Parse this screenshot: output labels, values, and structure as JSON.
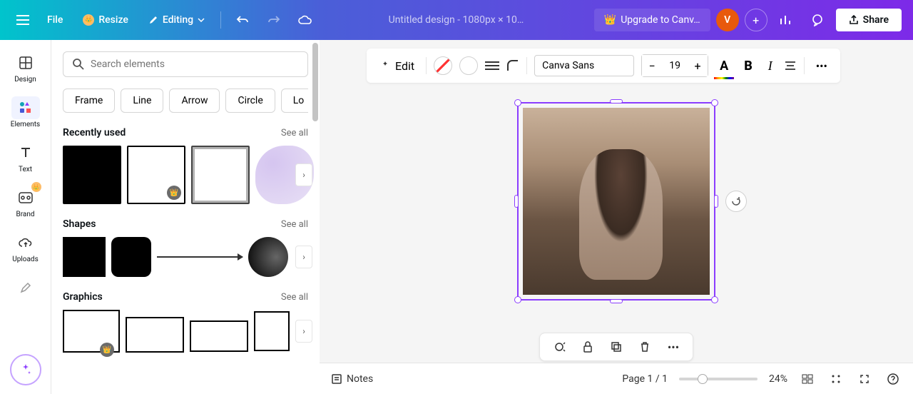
{
  "topbar": {
    "file": "File",
    "resize": "Resize",
    "editing": "Editing",
    "doc_title": "Untitled design - 1080px × 10…",
    "upgrade": "Upgrade to Canv…",
    "avatar_initial": "V",
    "share": "Share"
  },
  "rail": {
    "design": "Design",
    "elements": "Elements",
    "text": "Text",
    "brand": "Brand",
    "uploads": "Uploads"
  },
  "panel": {
    "search_placeholder": "Search elements",
    "chips": [
      "Frame",
      "Line",
      "Arrow",
      "Circle",
      "Lo"
    ],
    "recently_used": "Recently used",
    "shapes": "Shapes",
    "graphics": "Graphics",
    "see_all": "See all"
  },
  "context_bar": {
    "edit": "Edit",
    "font": "Canva Sans",
    "font_size": "19",
    "bold": "B",
    "italic": "I"
  },
  "footer": {
    "notes": "Notes",
    "page": "Page 1 / 1",
    "zoom": "24%"
  }
}
